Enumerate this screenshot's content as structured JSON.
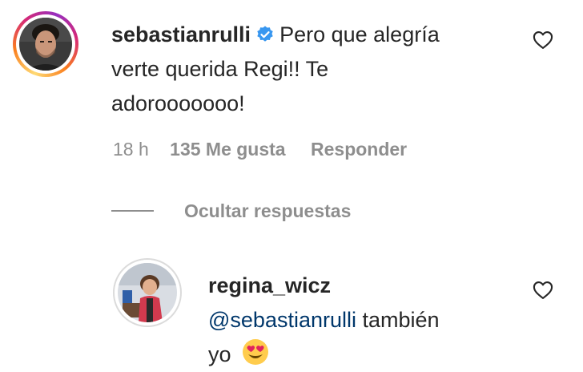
{
  "comment": {
    "username": "sebastianrulli",
    "verified": true,
    "text_line1": "Pero que alegría",
    "text_line2": "verte querida Regi!! Te",
    "text_line3": "adorooooooo!",
    "time": "18 h",
    "likes": "135 Me gusta",
    "reply_label": "Responder",
    "avatar_icon": "profile-photo-man",
    "like_icon": "heart-outline-icon"
  },
  "replies_toggle": {
    "label": "Ocultar respuestas"
  },
  "reply": {
    "username": "regina_wicz",
    "mention": "@sebastianrulli",
    "text_after_mention": "también",
    "text_line2": "yo",
    "emoji": "😍",
    "avatar_icon": "profile-photo-girl",
    "like_icon": "heart-outline-icon"
  },
  "colors": {
    "text": "#262626",
    "secondary": "#8e8e8e",
    "mention": "#00376b",
    "verified_badge": "#3897f0"
  }
}
